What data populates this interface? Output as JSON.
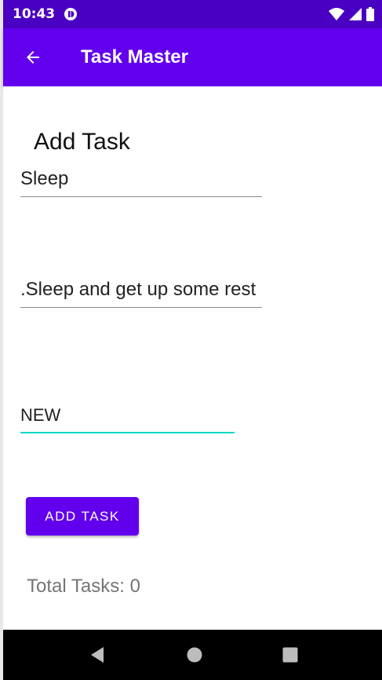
{
  "status_bar": {
    "time": "10:43",
    "icons": [
      "notification-icon",
      "wifi-icon",
      "signal-icon",
      "battery-icon"
    ]
  },
  "app_bar": {
    "title": "Task Master",
    "back_icon": "arrow-back-icon"
  },
  "form": {
    "heading": "Add Task",
    "title_value": "Sleep",
    "description_value": "Sleep and get up some rest.",
    "state_value": "NEW",
    "add_button_label": "ADD TASK"
  },
  "footer": {
    "total_text": "Total Tasks: 0"
  },
  "nav_bar": {
    "buttons": [
      "back-triangle-icon",
      "home-circle-icon",
      "recents-square-icon"
    ]
  },
  "colors": {
    "primary": "#6200ee",
    "primary_dark": "#4a00c2",
    "accent": "#03dac5"
  }
}
